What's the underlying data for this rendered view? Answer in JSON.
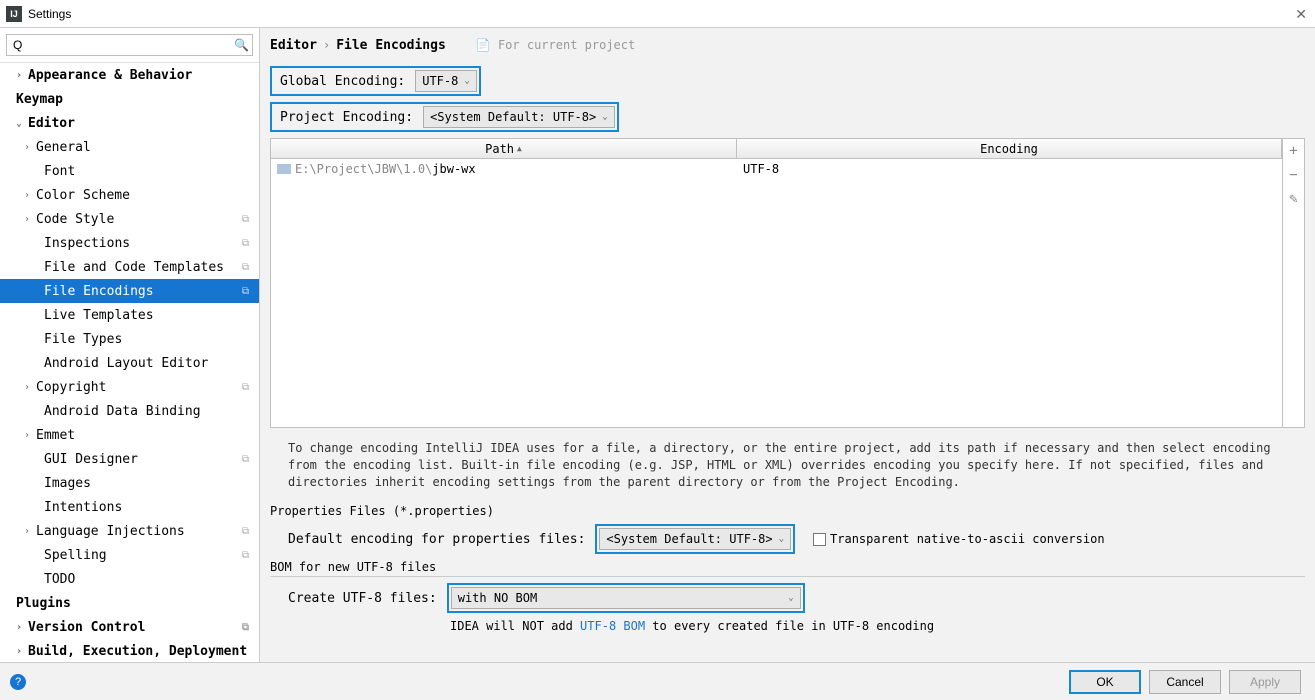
{
  "window": {
    "title": "Settings"
  },
  "search": {
    "placeholder": ""
  },
  "sidebar": {
    "items": [
      {
        "label": "Appearance & Behavior",
        "lvl": 1,
        "exp": true,
        "chev": "›",
        "bold": true
      },
      {
        "label": "Keymap",
        "lvl": 1,
        "bold": true,
        "chev": ""
      },
      {
        "label": "Editor",
        "lvl": 1,
        "exp": true,
        "chev": "⌄",
        "bold": true
      },
      {
        "label": "General",
        "lvl": 2,
        "chev": "›",
        "exp": true
      },
      {
        "label": "Font",
        "lvl": 3
      },
      {
        "label": "Color Scheme",
        "lvl": 2,
        "chev": "›",
        "exp": true
      },
      {
        "label": "Code Style",
        "lvl": 2,
        "chev": "›",
        "exp": true,
        "copy": true
      },
      {
        "label": "Inspections",
        "lvl": 3,
        "copy": true
      },
      {
        "label": "File and Code Templates",
        "lvl": 3,
        "copy": true
      },
      {
        "label": "File Encodings",
        "lvl": 3,
        "copy": true,
        "selected": true
      },
      {
        "label": "Live Templates",
        "lvl": 3
      },
      {
        "label": "File Types",
        "lvl": 3
      },
      {
        "label": "Android Layout Editor",
        "lvl": 3
      },
      {
        "label": "Copyright",
        "lvl": 2,
        "chev": "›",
        "exp": true,
        "copy": true
      },
      {
        "label": "Android Data Binding",
        "lvl": 3
      },
      {
        "label": "Emmet",
        "lvl": 2,
        "chev": "›",
        "exp": true
      },
      {
        "label": "GUI Designer",
        "lvl": 3,
        "copy": true
      },
      {
        "label": "Images",
        "lvl": 3
      },
      {
        "label": "Intentions",
        "lvl": 3
      },
      {
        "label": "Language Injections",
        "lvl": 2,
        "chev": "›",
        "exp": true,
        "copy": true
      },
      {
        "label": "Spelling",
        "lvl": 3,
        "copy": true
      },
      {
        "label": "TODO",
        "lvl": 3
      },
      {
        "label": "Plugins",
        "lvl": 1,
        "bold": true,
        "chev": ""
      },
      {
        "label": "Version Control",
        "lvl": 1,
        "exp": true,
        "chev": "›",
        "bold": true,
        "copy": true
      },
      {
        "label": "Build, Execution, Deployment",
        "lvl": 1,
        "exp": true,
        "chev": "›",
        "bold": true
      }
    ]
  },
  "breadcrumb": {
    "a": "Editor",
    "b": "File Encodings",
    "tag": "For current project"
  },
  "encoding": {
    "global_label": "Global Encoding:",
    "global_value": "UTF-8",
    "project_label": "Project Encoding:",
    "project_value": "<System Default: UTF-8>"
  },
  "table": {
    "col_path": "Path",
    "col_enc": "Encoding",
    "rows": [
      {
        "prefix": "E:\\Project\\JBW\\1.0\\",
        "name": "jbw-wx",
        "encoding": "UTF-8"
      }
    ]
  },
  "help": "To change encoding IntelliJ IDEA uses for a file, a directory, or the entire project, add its path if necessary and then select encoding from the encoding list. Built-in file encoding (e.g. JSP, HTML or XML) overrides encoding you specify here. If not specified, files and directories inherit encoding settings from the parent directory or from the Project Encoding.",
  "props": {
    "section": "Properties Files (*.properties)",
    "label": "Default encoding for properties files:",
    "value": "<System Default: UTF-8>",
    "checkbox": "Transparent native-to-ascii conversion"
  },
  "bom": {
    "section": "BOM for new UTF-8 files",
    "label": "Create UTF-8 files:",
    "value": "with NO BOM",
    "note_a": "IDEA will NOT add ",
    "note_link": "UTF-8 BOM",
    "note_b": " to every created file in UTF-8 encoding"
  },
  "buttons": {
    "ok": "OK",
    "cancel": "Cancel",
    "apply": "Apply"
  }
}
